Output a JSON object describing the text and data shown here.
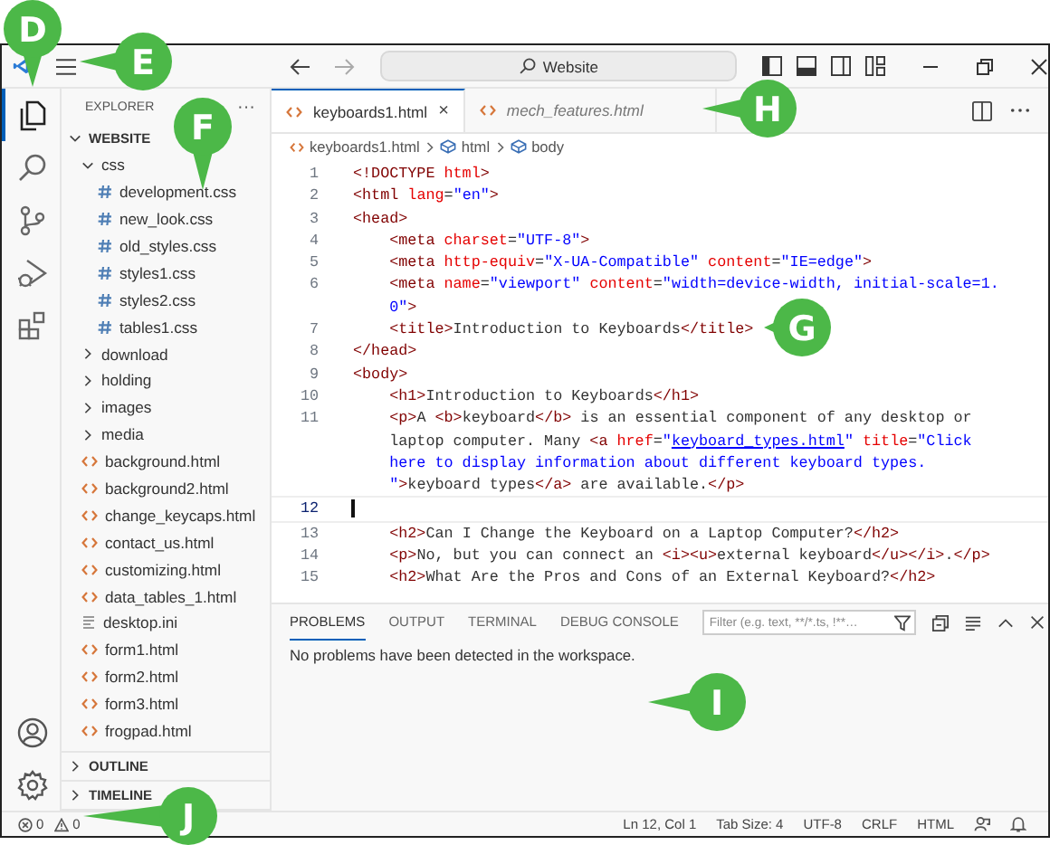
{
  "title_bar": {
    "search": "Website"
  },
  "activity_bar": {
    "top": [
      {
        "kind": "files",
        "selected": true
      },
      {
        "kind": "search",
        "selected": false
      },
      {
        "kind": "source-control",
        "selected": false
      },
      {
        "kind": "run",
        "selected": false
      },
      {
        "kind": "extensions",
        "selected": false
      }
    ],
    "bottom": [
      {
        "kind": "account",
        "selected": false
      },
      {
        "kind": "settings",
        "selected": false
      }
    ]
  },
  "sidebar": {
    "title": "EXPLORER",
    "more": "···",
    "root": {
      "label": "WEBSITE",
      "expanded": true,
      "children": [
        {
          "label": "css",
          "kind": "folder",
          "expanded": true,
          "children": [
            {
              "label": "development.css",
              "kind": "css"
            },
            {
              "label": "new_look.css",
              "kind": "css"
            },
            {
              "label": "old_styles.css",
              "kind": "css"
            },
            {
              "label": "styles1.css",
              "kind": "css"
            },
            {
              "label": "styles2.css",
              "kind": "css"
            },
            {
              "label": "tables1.css",
              "kind": "css"
            }
          ]
        },
        {
          "label": "download",
          "kind": "folder",
          "expanded": false
        },
        {
          "label": "holding",
          "kind": "folder",
          "expanded": false
        },
        {
          "label": "images",
          "kind": "folder",
          "expanded": false
        },
        {
          "label": "media",
          "kind": "folder",
          "expanded": false
        },
        {
          "label": "background.html",
          "kind": "html"
        },
        {
          "label": "background2.html",
          "kind": "html"
        },
        {
          "label": "change_keycaps.html",
          "kind": "html"
        },
        {
          "label": "contact_us.html",
          "kind": "html"
        },
        {
          "label": "customizing.html",
          "kind": "html"
        },
        {
          "label": "data_tables_1.html",
          "kind": "html"
        },
        {
          "label": "desktop.ini",
          "kind": "text"
        },
        {
          "label": "form1.html",
          "kind": "html"
        },
        {
          "label": "form2.html",
          "kind": "html"
        },
        {
          "label": "form3.html",
          "kind": "html"
        },
        {
          "label": "frogpad.html",
          "kind": "html"
        }
      ]
    },
    "sections": [
      {
        "label": "OUTLINE",
        "expanded": false
      },
      {
        "label": "TIMELINE",
        "expanded": false
      }
    ]
  },
  "tabs": [
    {
      "label": "keyboards1.html",
      "selected": true,
      "preview": false,
      "close": "×"
    },
    {
      "label": "mech_features.html",
      "selected": false,
      "preview": true
    }
  ],
  "breadcrumb": [
    "keyboards1.html",
    "html",
    "body"
  ],
  "code": [
    {
      "num": "1",
      "current": false,
      "rows": [
        {
          "tokens": [
            {
              "kind": "tag",
              "text": "<!DOCTYPE"
            },
            {
              "kind": "attr",
              "text": " html"
            },
            {
              "kind": "tag",
              "text": ">"
            }
          ]
        }
      ]
    },
    {
      "num": "2",
      "current": false,
      "rows": [
        {
          "tokens": [
            {
              "kind": "tag",
              "text": "<html"
            },
            {
              "kind": "attr",
              "text": " lang"
            },
            {
              "kind": "plain",
              "text": "="
            },
            {
              "kind": "str",
              "text": "\"en\""
            },
            {
              "kind": "tag",
              "text": ">"
            }
          ]
        }
      ]
    },
    {
      "num": "3",
      "current": false,
      "rows": [
        {
          "tokens": [
            {
              "kind": "tag",
              "text": "<head>"
            }
          ]
        }
      ]
    },
    {
      "num": "4",
      "current": false,
      "rows": [
        {
          "tokens": [
            {
              "kind": "tag",
              "text": "    <meta"
            },
            {
              "kind": "attr",
              "text": " charset"
            },
            {
              "kind": "plain",
              "text": "="
            },
            {
              "kind": "str",
              "text": "\"UTF-8\""
            },
            {
              "kind": "tag",
              "text": ">"
            }
          ]
        }
      ]
    },
    {
      "num": "5",
      "current": false,
      "rows": [
        {
          "tokens": [
            {
              "kind": "tag",
              "text": "    <meta"
            },
            {
              "kind": "attr",
              "text": " http-equiv"
            },
            {
              "kind": "plain",
              "text": "="
            },
            {
              "kind": "str",
              "text": "\"X-UA-Compatible\""
            },
            {
              "kind": "attr",
              "text": " content"
            },
            {
              "kind": "plain",
              "text": "="
            },
            {
              "kind": "str",
              "text": "\"IE=edge\""
            },
            {
              "kind": "tag",
              "text": ">"
            }
          ]
        }
      ]
    },
    {
      "num": "6",
      "current": false,
      "rows": [
        {
          "tokens": [
            {
              "kind": "tag",
              "text": "    <meta"
            },
            {
              "kind": "attr",
              "text": " name"
            },
            {
              "kind": "plain",
              "text": "="
            },
            {
              "kind": "str",
              "text": "\"viewport\""
            },
            {
              "kind": "attr",
              "text": " content"
            },
            {
              "kind": "plain",
              "text": "="
            },
            {
              "kind": "str",
              "text": "\"width=device-width, initial-scale=1."
            }
          ]
        },
        {
          "tokens": [
            {
              "kind": "str",
              "text": "    0\""
            },
            {
              "kind": "tag",
              "text": ">"
            }
          ]
        }
      ]
    },
    {
      "num": "7",
      "current": false,
      "rows": [
        {
          "tokens": [
            {
              "kind": "tag",
              "text": "    <title>"
            },
            {
              "kind": "plain",
              "text": "Introduction to Keyboards"
            },
            {
              "kind": "tag",
              "text": "</title>"
            }
          ]
        }
      ]
    },
    {
      "num": "8",
      "current": false,
      "rows": [
        {
          "tokens": [
            {
              "kind": "tag",
              "text": "</head>"
            }
          ]
        }
      ]
    },
    {
      "num": "9",
      "current": false,
      "rows": [
        {
          "tokens": [
            {
              "kind": "tag",
              "text": "<body>"
            }
          ]
        }
      ]
    },
    {
      "num": "10",
      "current": false,
      "rows": [
        {
          "tokens": [
            {
              "kind": "tag",
              "text": "    <h1>"
            },
            {
              "kind": "plain",
              "text": "Introduction to Keyboards"
            },
            {
              "kind": "tag",
              "text": "</h1>"
            }
          ]
        }
      ]
    },
    {
      "num": "11",
      "current": false,
      "rows": [
        {
          "tokens": [
            {
              "kind": "tag",
              "text": "    <p>"
            },
            {
              "kind": "plain",
              "text": "A "
            },
            {
              "kind": "tag",
              "text": "<b>"
            },
            {
              "kind": "plain",
              "text": "keyboard"
            },
            {
              "kind": "tag",
              "text": "</b>"
            },
            {
              "kind": "plain",
              "text": " is an essential component of any desktop or"
            }
          ]
        },
        {
          "tokens": [
            {
              "kind": "plain",
              "text": "    laptop computer. Many "
            },
            {
              "kind": "tag",
              "text": "<a"
            },
            {
              "kind": "attr",
              "text": " href"
            },
            {
              "kind": "plain",
              "text": "="
            },
            {
              "kind": "str",
              "text": "\""
            },
            {
              "kind": "link",
              "text": "keyboard_types.html"
            },
            {
              "kind": "str",
              "text": "\""
            },
            {
              "kind": "attr",
              "text": " title"
            },
            {
              "kind": "plain",
              "text": "="
            },
            {
              "kind": "str",
              "text": "\"Click"
            }
          ]
        },
        {
          "tokens": [
            {
              "kind": "str",
              "text": "    here to display information about different keyboard types."
            }
          ]
        },
        {
          "tokens": [
            {
              "kind": "str",
              "text": "    \""
            },
            {
              "kind": "tag",
              "text": ">"
            },
            {
              "kind": "plain",
              "text": "keyboard types"
            },
            {
              "kind": "tag",
              "text": "</a>"
            },
            {
              "kind": "plain",
              "text": " are available."
            },
            {
              "kind": "tag",
              "text": "</p>"
            }
          ]
        }
      ]
    },
    {
      "num": "12",
      "current": true
    },
    {
      "num": "13",
      "current": false,
      "rows": [
        {
          "tokens": [
            {
              "kind": "tag",
              "text": "    <h2>"
            },
            {
              "kind": "plain",
              "text": "Can I Change the Keyboard on a Laptop Computer?"
            },
            {
              "kind": "tag",
              "text": "</h2>"
            }
          ]
        }
      ]
    },
    {
      "num": "14",
      "current": false,
      "rows": [
        {
          "tokens": [
            {
              "kind": "tag",
              "text": "    <p>"
            },
            {
              "kind": "plain",
              "text": "No, but you can connect an "
            },
            {
              "kind": "tag",
              "text": "<i><u>"
            },
            {
              "kind": "plain",
              "text": "external keyboard"
            },
            {
              "kind": "tag",
              "text": "</u></i>"
            },
            {
              "kind": "plain",
              "text": "."
            },
            {
              "kind": "tag",
              "text": "</p>"
            }
          ]
        }
      ]
    },
    {
      "num": "15",
      "current": false,
      "rows": [
        {
          "tokens": [
            {
              "kind": "tag",
              "text": "    <h2>"
            },
            {
              "kind": "plain",
              "text": "What Are the Pros and Cons of an External Keyboard?"
            },
            {
              "kind": "tag",
              "text": "</h2>"
            }
          ]
        }
      ]
    }
  ],
  "panel": {
    "tabs": [
      {
        "label": "PROBLEMS",
        "selected": true
      },
      {
        "label": "OUTPUT",
        "selected": false
      },
      {
        "label": "TERMINAL",
        "selected": false
      },
      {
        "label": "DEBUG CONSOLE",
        "selected": false
      }
    ],
    "filter": {
      "placeholder": "Filter (e.g. text, **/*.ts, !**…"
    },
    "message": "No problems have been detected in the workspace."
  },
  "status_bar": {
    "errors": "0",
    "warnings": "0",
    "items": [
      "Ln 12, Col 1",
      "Tab Size: 4",
      "UTF-8",
      "CRLF",
      "HTML"
    ]
  },
  "callouts": [
    {
      "letter": "D",
      "kind": "down"
    },
    {
      "letter": "E",
      "kind": "left"
    },
    {
      "letter": "F",
      "kind": "down"
    },
    {
      "letter": "G",
      "kind": "left"
    },
    {
      "letter": "H",
      "kind": "left"
    },
    {
      "letter": "I",
      "kind": "left"
    },
    {
      "letter": "J",
      "kind": "left"
    }
  ]
}
